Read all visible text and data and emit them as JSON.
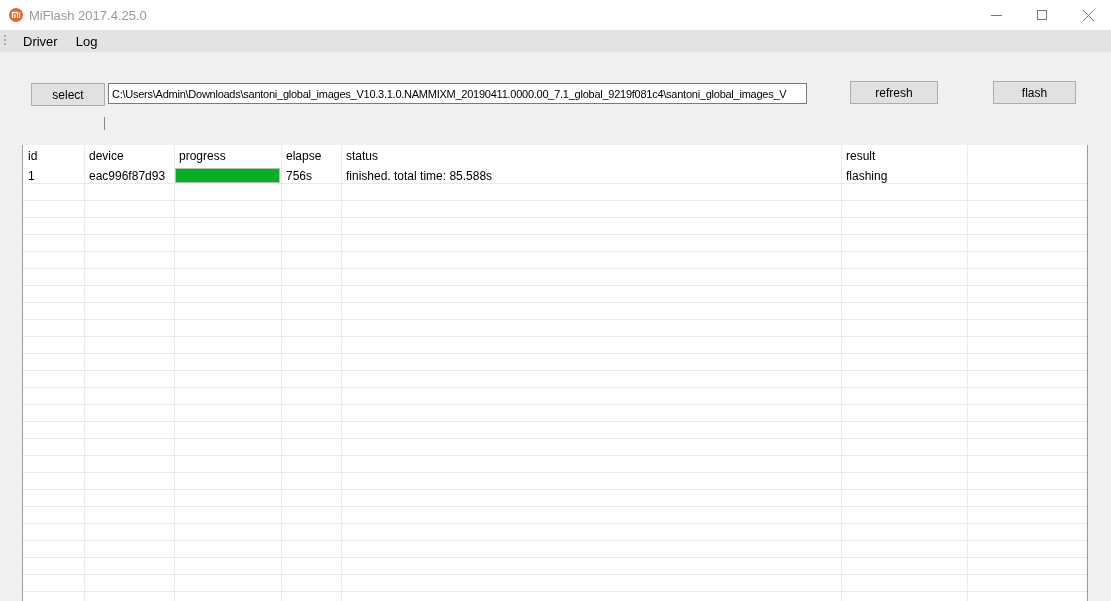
{
  "window": {
    "title": "MiFlash 2017.4.25.0"
  },
  "menu": [
    "Driver",
    "Log"
  ],
  "toolbar": {
    "select_button": "select",
    "path": "C:\\Users\\Admin\\Downloads\\santoni_global_images_V10.3.1.0.NAMMIXM_20190411.0000.00_7.1_global_9219f081c4\\santoni_global_images_V",
    "refresh_button": "refresh",
    "flash_button": "flash"
  },
  "table": {
    "columns": [
      "id",
      "device",
      "progress",
      "elapse",
      "status",
      "result"
    ],
    "rows": [
      {
        "id": "1",
        "device": "eac996f87d93",
        "progress": {
          "level": 1
        },
        "elapse": "756s",
        "status": "finished. total time: 85.588s",
        "result": "flashing"
      }
    ]
  }
}
